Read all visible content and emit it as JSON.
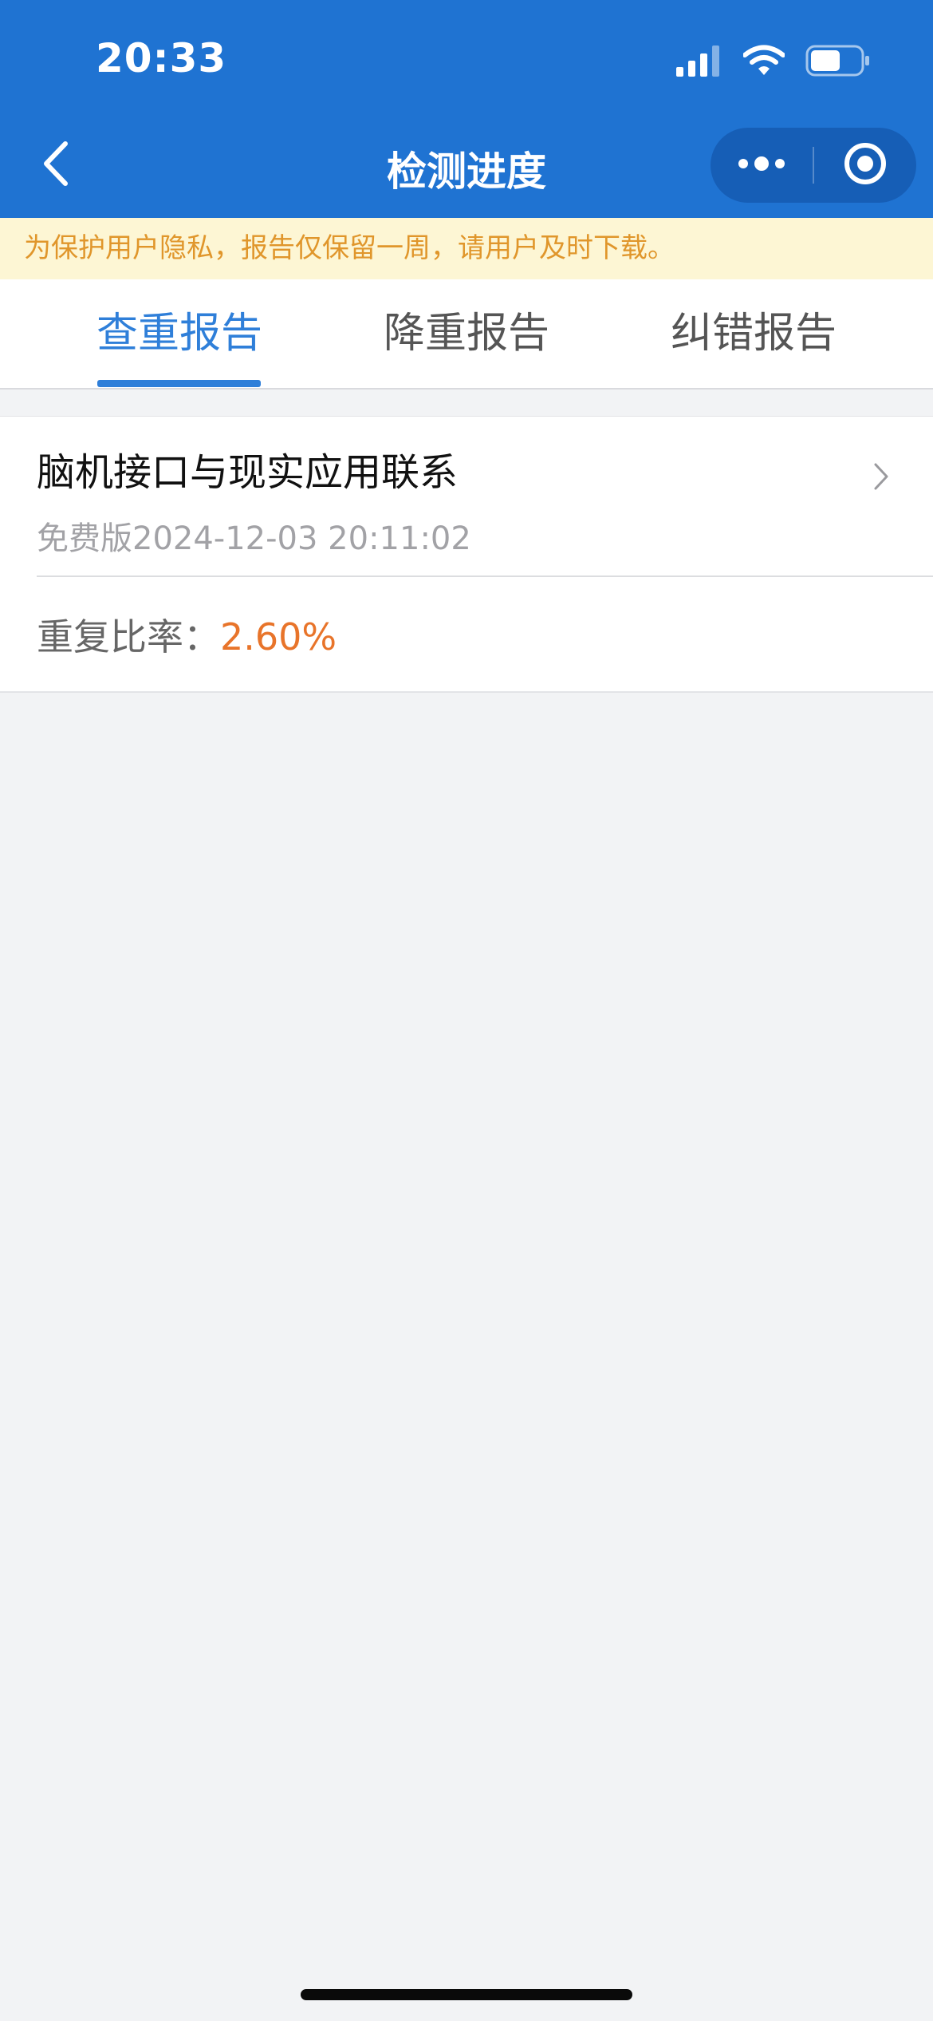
{
  "status_bar": {
    "time": "20:33",
    "battery_level": 0.6
  },
  "nav": {
    "title": "检测进度",
    "back_icon": "chevron-left-icon",
    "more_icon": "more-dots-icon",
    "close_icon": "target-circle-icon"
  },
  "notice": {
    "text": "为保护用户隐私，报告仅保留一周，请用户及时下载。"
  },
  "tabs": [
    {
      "label": "查重报告",
      "active": true
    },
    {
      "label": "降重报告",
      "active": false
    },
    {
      "label": "纠错报告",
      "active": false
    }
  ],
  "report": {
    "title": "脑机接口与现实应用联系",
    "meta": "免费版2024-12-03 20:11:02",
    "rate_label": "重复比率：",
    "rate_value": "2.60%"
  },
  "colors": {
    "header": "#1f73d2",
    "accent": "#2f7fd9",
    "notice_bg": "#fdf6d4",
    "notice_text": "#e0962b",
    "rate": "#e8742a"
  }
}
